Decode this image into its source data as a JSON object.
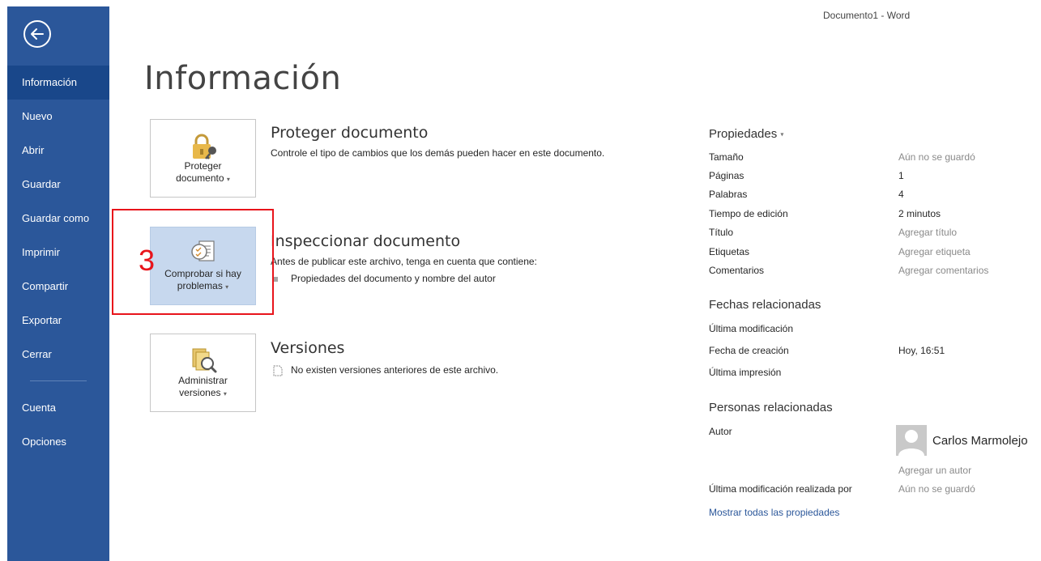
{
  "window": {
    "title": "Documento1 - Word"
  },
  "sidebar": {
    "back_icon": "back-arrow-circle-icon",
    "items": [
      {
        "label": "Información",
        "active": true
      },
      {
        "label": "Nuevo"
      },
      {
        "label": "Abrir"
      },
      {
        "label": "Guardar"
      },
      {
        "label": "Guardar como"
      },
      {
        "label": "Imprimir"
      },
      {
        "label": "Compartir"
      },
      {
        "label": "Exportar"
      },
      {
        "label": "Cerrar"
      },
      {
        "label": "Cuenta"
      },
      {
        "label": "Opciones"
      }
    ]
  },
  "main": {
    "title": "Información",
    "protect": {
      "tile_line1": "Proteger",
      "tile_line2": "documento",
      "icon": "lock-key-icon",
      "heading": "Proteger documento",
      "description": "Controle el tipo de cambios que los demás pueden hacer en este documento."
    },
    "inspect": {
      "tile_line1": "Comprobar si hay",
      "tile_line2": "problemas",
      "icon": "inspect-document-icon",
      "heading": "Inspeccionar documento",
      "description": "Antes de publicar este archivo, tenga en cuenta que contiene:",
      "bullet": "Propiedades del documento y nombre del autor"
    },
    "versions": {
      "tile_line1": "Administrar",
      "tile_line2": "versiones",
      "icon": "manage-versions-icon",
      "heading": "Versiones",
      "description": "No existen versiones anteriores de este archivo."
    }
  },
  "annotation": {
    "number": "3",
    "color": "#e8141b"
  },
  "properties": {
    "heading": "Propiedades",
    "rows": [
      {
        "label": "Tamaño",
        "value": "Aún no se guardó"
      },
      {
        "label": "Páginas",
        "value": "1"
      },
      {
        "label": "Palabras",
        "value": "4"
      },
      {
        "label": "Tiempo de edición",
        "value": "2 minutos"
      },
      {
        "label": "Título",
        "value": "Agregar título"
      },
      {
        "label": "Etiquetas",
        "value": "Agregar etiqueta"
      },
      {
        "label": "Comentarios",
        "value": "Agregar comentarios"
      }
    ],
    "dates_heading": "Fechas relacionadas",
    "dates": [
      {
        "label": "Última modificación",
        "value": ""
      },
      {
        "label": "Fecha de creación",
        "value": "Hoy, 16:51"
      },
      {
        "label": "Última impresión",
        "value": ""
      }
    ],
    "people_heading": "Personas relacionadas",
    "author_label": "Autor",
    "author_name": "Carlos Marmolejo",
    "add_author": "Agregar un autor",
    "last_modified_by_label": "Última modificación realizada por",
    "last_modified_by_value": "Aún no se guardó",
    "show_all_link": "Mostrar todas las propiedades"
  },
  "colors": {
    "sidebar": "#2b579a",
    "sidebar_active": "#19478a",
    "selected_tile": "#c7d8ee",
    "link": "#2b579a"
  }
}
